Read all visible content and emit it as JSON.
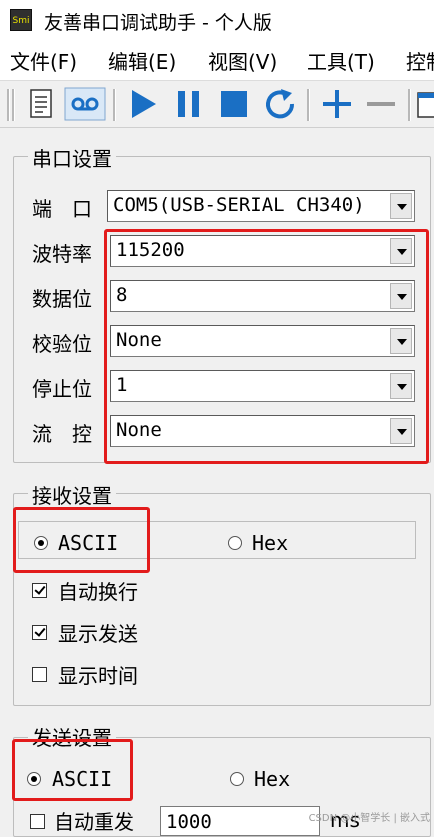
{
  "window": {
    "title": "友善串口调试助手 - 个人版",
    "icon_label": "Smi"
  },
  "menu": [
    {
      "label": "文件(F)"
    },
    {
      "label": "编辑(E)"
    },
    {
      "label": "视图(V)"
    },
    {
      "label": "工具(T)"
    },
    {
      "label": "控制"
    }
  ],
  "serial_settings": {
    "title": "串口设置",
    "rows": [
      {
        "label": "端　口",
        "value": "COM5(USB-SERIAL CH340)"
      },
      {
        "label": "波特率",
        "value": "115200"
      },
      {
        "label": "数据位",
        "value": "8"
      },
      {
        "label": "校验位",
        "value": "None"
      },
      {
        "label": "停止位",
        "value": "1"
      },
      {
        "label": "流　控",
        "value": "None"
      }
    ]
  },
  "receive_settings": {
    "title": "接收设置",
    "mode_ascii": "ASCII",
    "mode_hex": "Hex",
    "selected": "ASCII",
    "options": [
      {
        "label": "自动换行",
        "checked": true
      },
      {
        "label": "显示发送",
        "checked": true
      },
      {
        "label": "显示时间",
        "checked": false
      }
    ]
  },
  "send_settings": {
    "title": "发送设置",
    "mode_ascii": "ASCII",
    "mode_hex": "Hex",
    "selected": "ASCII",
    "auto_resend_label": "自动重发",
    "auto_resend_checked": false,
    "interval_value": "1000",
    "interval_unit": "ms"
  },
  "watermark": "CSDN @小智学长 | 嵌入式",
  "colors": {
    "highlight": "#e21b1b",
    "toolbar_icon": "#1a6fc4"
  }
}
